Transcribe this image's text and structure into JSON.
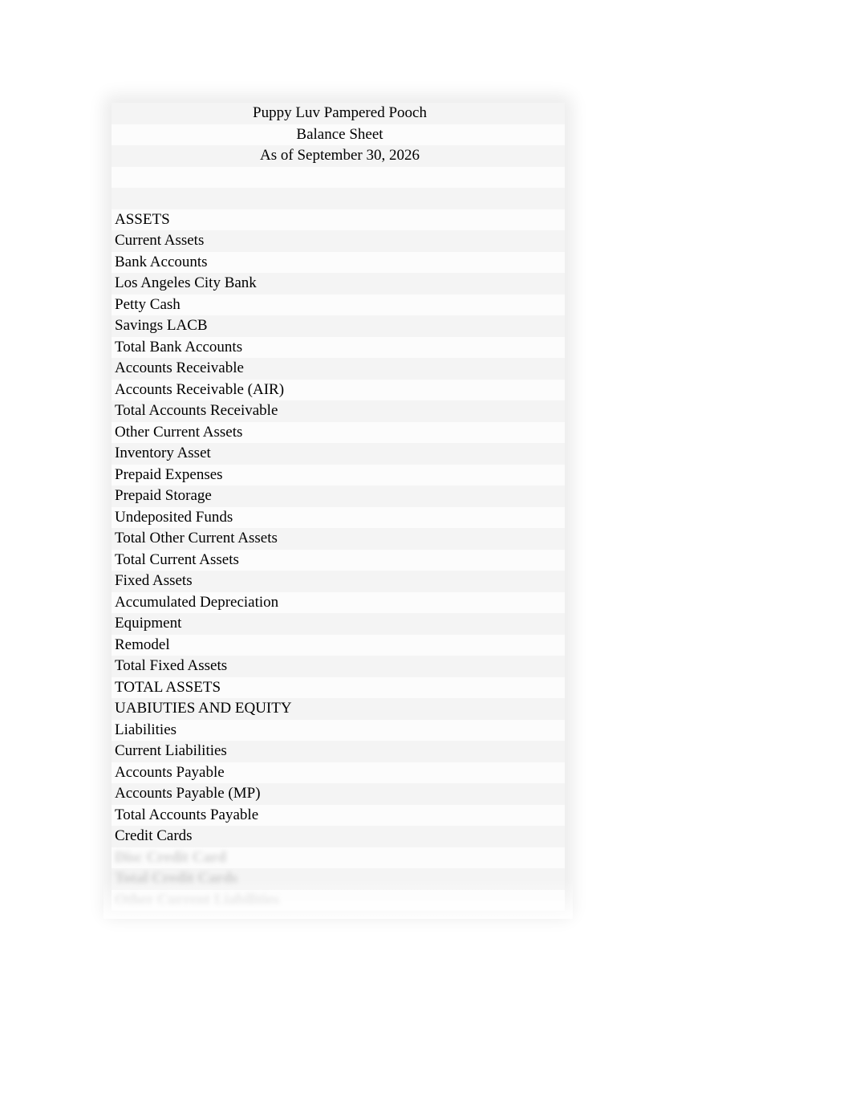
{
  "header": {
    "company": "Puppy Luv Pampered Pooch",
    "report_title": "Balance Sheet",
    "as_of": "As of September 30, 2026"
  },
  "rows": [
    "ASSETS",
    "Current Assets",
    "Bank Accounts",
    "Los Angeles City Bank",
    "Petty Cash",
    "Savings LACB",
    "Total Bank Accounts",
    "Accounts Receivable",
    "Accounts Receivable (AIR)",
    "Total Accounts Receivable",
    "Other Current Assets",
    "Inventory Asset",
    "Prepaid Expenses",
    "Prepaid Storage",
    "Undeposited Funds",
    "Total Other Current Assets",
    "Total Current Assets",
    "Fixed Assets",
    "Accumulated Depreciation",
    "Equipment",
    "Remodel",
    "Total Fixed Assets",
    "TOTAL ASSETS",
    "UABIUTIES AND EQUITY",
    "Liabilities",
    "Current Liabilities",
    "Accounts Payable",
    "Accounts Payable (MP)",
    "Total Accounts Payable",
    "Credit Cards"
  ],
  "blurred_rows": [
    "Disc Credit Card",
    "Total Credit Cards",
    "Other Current Liabilities"
  ]
}
